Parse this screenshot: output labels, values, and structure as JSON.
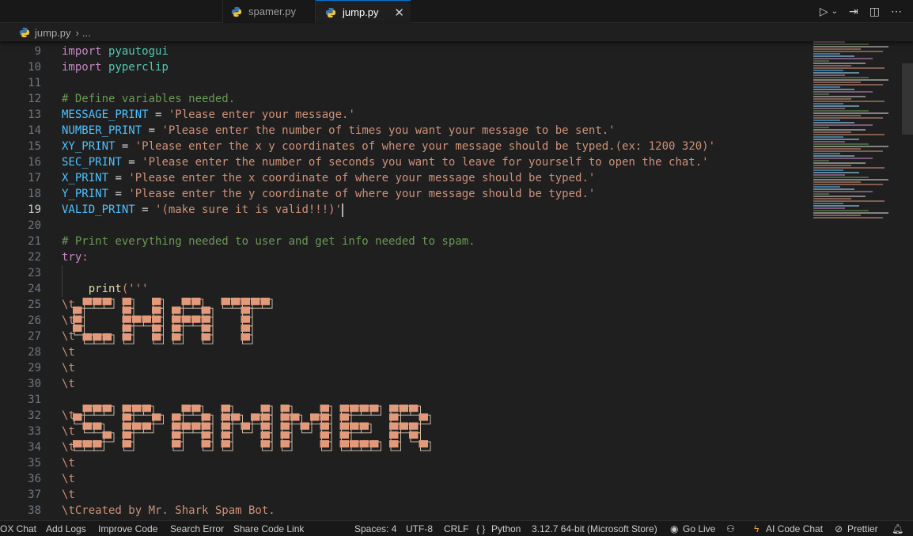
{
  "tabs": [
    {
      "label": "spamer.py",
      "active": false
    },
    {
      "label": "jump.py",
      "active": true
    }
  ],
  "breadcrumb": {
    "file": "jump.py",
    "more": "..."
  },
  "editor": {
    "line_numbers": [
      "9",
      "10",
      "11",
      "12",
      "13",
      "14",
      "15",
      "16",
      "17",
      "18",
      "19",
      "20",
      "21",
      "22",
      "23",
      "24",
      "25",
      "26",
      "27",
      "28",
      "29",
      "30",
      "31",
      "32",
      "33",
      "34",
      "35",
      "36",
      "37",
      "38"
    ],
    "active_line": "19",
    "lines": {
      "l9_kw": "import",
      "l9_mod": "pyautogui",
      "l10_kw": "import",
      "l10_mod": "pyperclip",
      "l12": "# Define variables needed.",
      "l13_var": "MESSAGE_PRINT",
      "l13_str": "'Please enter your message.'",
      "l14_var": "NUMBER_PRINT",
      "l14_str": "'Please enter the number of times you want your message to be sent.'",
      "l15_var": "XY_PRINT",
      "l15_str": "'Please enter the x y coordinates of where your message should be typed.(ex: 1200 320)'",
      "l16_var": "SEC_PRINT",
      "l16_str": "'Please enter the number of seconds you want to leave for yourself to open the chat.'",
      "l17_var": "X_PRINT",
      "l17_str": "'Please enter the x coordinate of where your message should be typed.'",
      "l18_var": "Y_PRINT",
      "l18_str": "'Please enter the y coordinate of where your message should be typed.'",
      "l19_var": "VALID_PRINT",
      "l19_str": "'(make sure it is valid!!!)'",
      "l21": "# Print everything needed to user and get info needed to spam.",
      "l22": "try:",
      "l24_fn": "print",
      "l24_str": "('''",
      "tab_prefix": "\\t",
      "l38": "\\tCreated by Mr. Shark Spam Bot."
    },
    "ascii_art": {
      "word1": "CHAT",
      "word2": "SPAMMER"
    }
  },
  "statusbar": {
    "left": [
      "OX Chat",
      "Add Logs",
      "Improve Code",
      "Search Error",
      "Share Code Link"
    ],
    "spaces": "Spaces: 4",
    "encoding": "UTF-8",
    "eol": "CRLF",
    "language_icon": "{ }",
    "language": "Python",
    "interpreter": "3.12.7 64-bit (Microsoft Store)",
    "golive": "Go Live",
    "ai_chat": "AI Code Chat",
    "prettier": "Prettier"
  },
  "colors": {
    "accent": "#0078d4",
    "keyword": "#c586c0",
    "string": "#ce9178",
    "comment": "#6a9955",
    "variable": "#4fc1ff",
    "module": "#4ec9b0",
    "art_fill": "#e39a7a"
  }
}
